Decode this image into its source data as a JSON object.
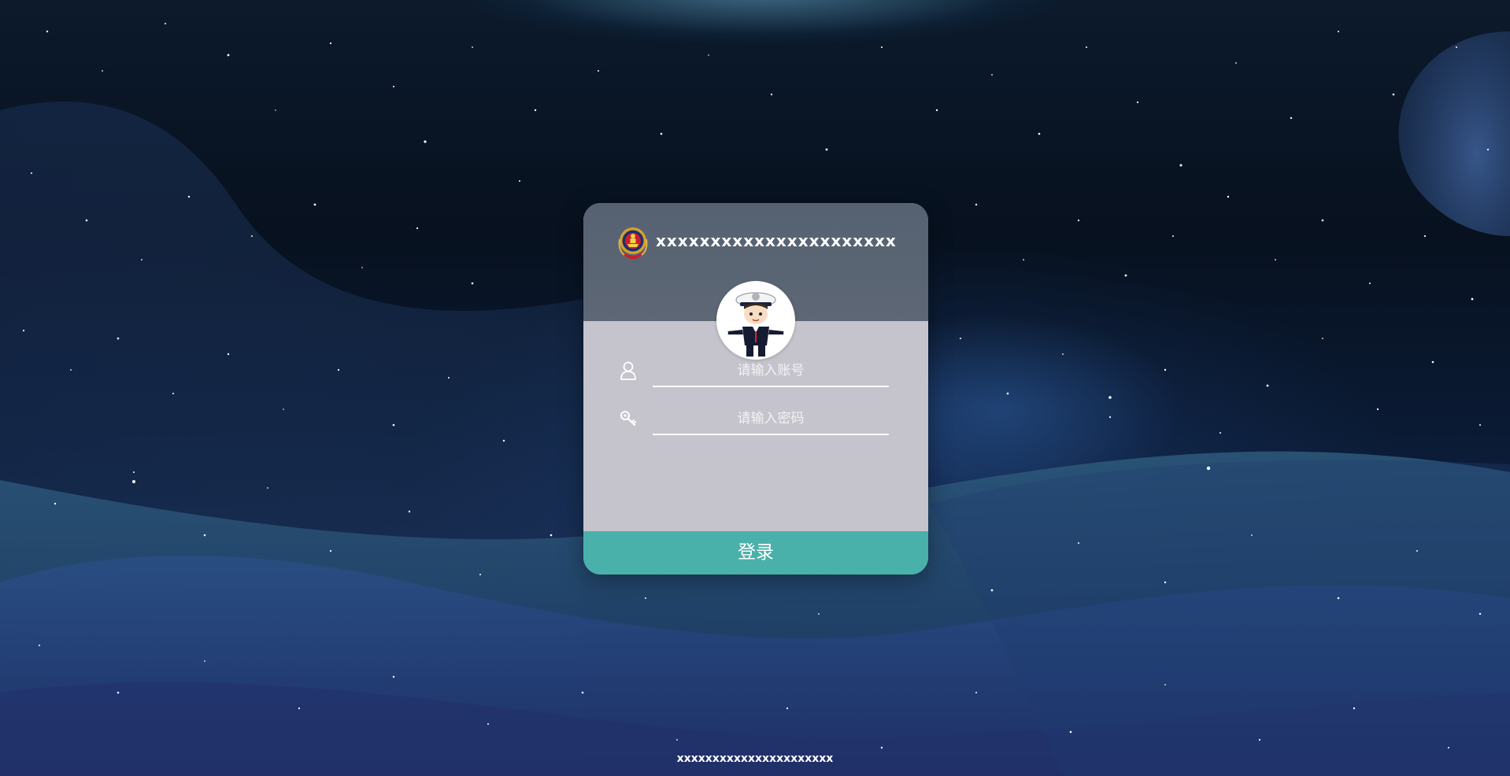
{
  "header": {
    "system_title": "xxxxxxxxxxxxxxxxxxxxxx",
    "emblem_icon": "police-emblem-icon",
    "avatar_icon": "police-officer-avatar"
  },
  "form": {
    "username": {
      "icon": "user-icon",
      "placeholder": "请输入账号",
      "value": ""
    },
    "password": {
      "icon": "key-icon",
      "placeholder": "请输入密码",
      "value": ""
    },
    "login_label": "登录"
  },
  "footer": {
    "text": "xxxxxxxxxxxxxxxxxxxxxx"
  },
  "colors": {
    "card_header": "#5d6775",
    "card_body": "#c5c4cc",
    "login_button": "#49b1aa",
    "background": "#07111f"
  }
}
